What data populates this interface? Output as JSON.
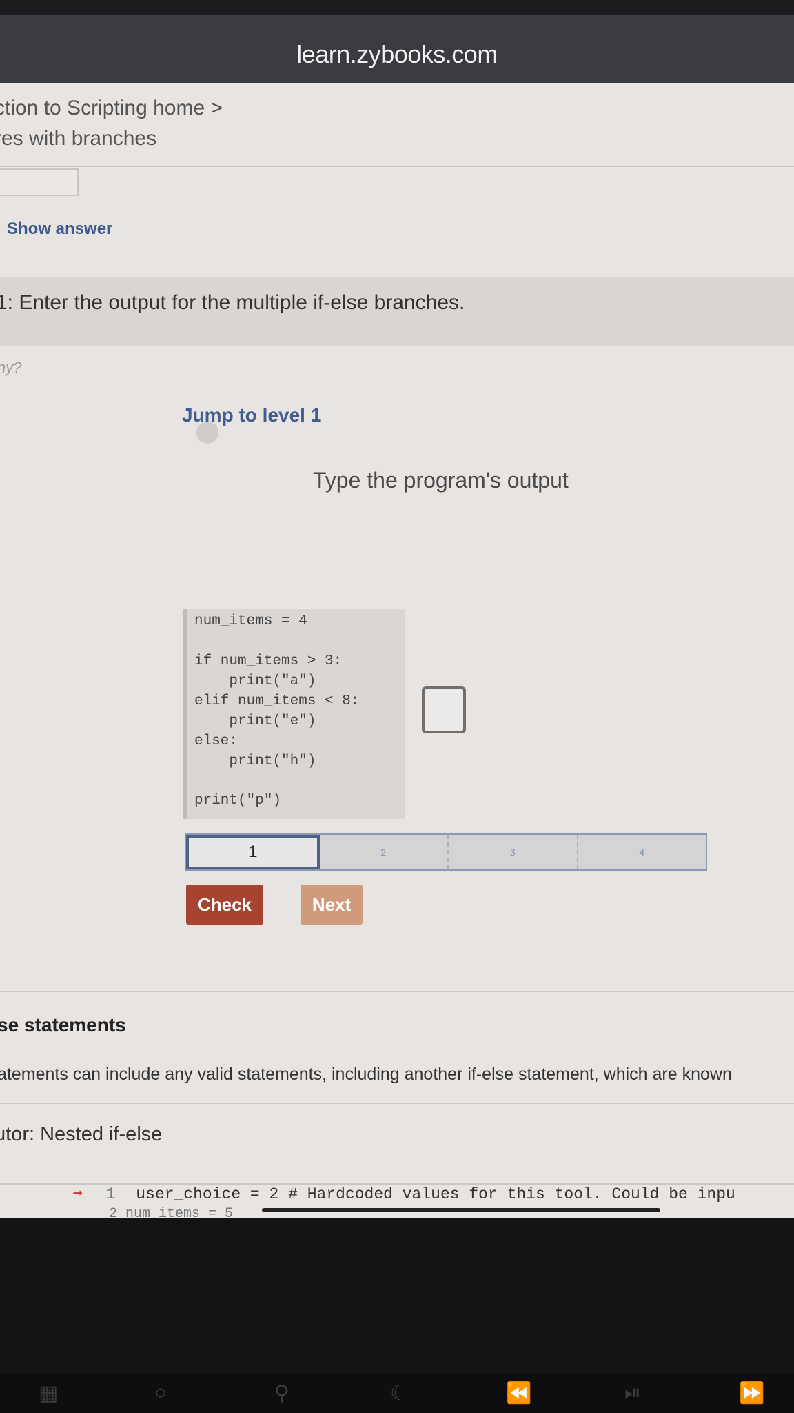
{
  "browser": {
    "url": "learn.zybooks.com"
  },
  "breadcrumb": {
    "line1": "ction to Scripting home >",
    "line2": "res with branches"
  },
  "show_answer_label": "Show answer",
  "activity": {
    "title": "1: Enter the output for the multiple if-else branches.",
    "question_icon_text": "ny?",
    "jump_label": "Jump to level 1",
    "instruction": "Type the program's output",
    "code_lines": [
      "num_items = 4",
      "if num_items > 3:",
      "    print(\"a\")",
      "elif num_items < 8:",
      "    print(\"e\")",
      "else:",
      "    print(\"h\")",
      "print(\"p\")"
    ],
    "answer_value": "",
    "levels": [
      "1",
      "2",
      "3",
      "4"
    ],
    "check_label": "Check",
    "next_label": "Next"
  },
  "section": {
    "title": "se statements",
    "text": "atements can include any valid statements, including another if-else statement, which are known",
    "subtitle": "utor: Nested if-else"
  },
  "editor": {
    "line1_num": "1",
    "line1_code": "user_choice = 2  # Hardcoded values for this tool. Could be inpu",
    "line2_text": "2  num_items = 5"
  },
  "colors": {
    "accent_blue": "#3f5d90",
    "check_button": "#a64431",
    "next_button": "#cf9b7c"
  },
  "navbar_icons": [
    "grid-icon",
    "circle-icon",
    "pin-icon",
    "moon-icon",
    "rewind-icon",
    "play-pause-icon",
    "fast-forward-icon"
  ]
}
